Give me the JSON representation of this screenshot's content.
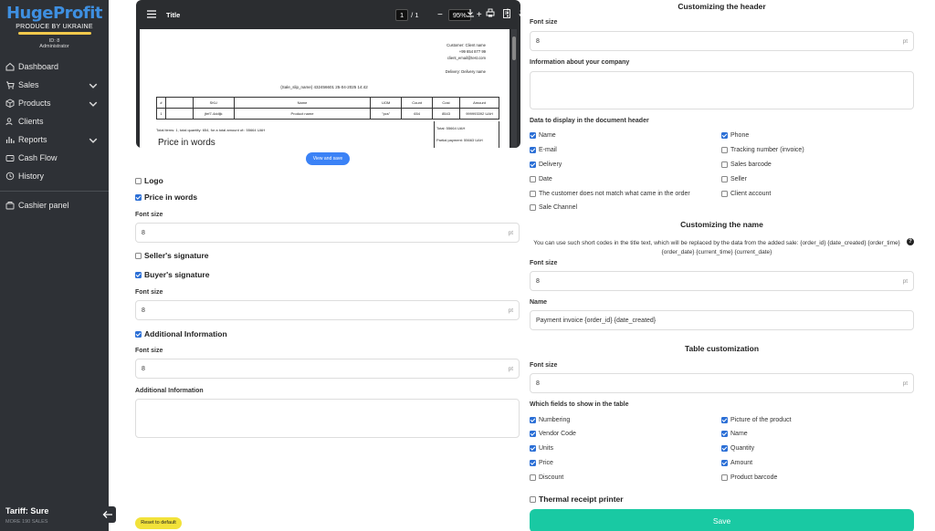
{
  "sidebar": {
    "logo_title": "HugeProfit",
    "logo_sub": "PRODUCE BY UKRAINE",
    "user_id": "ID: 8",
    "user_role": "Administrator",
    "items": [
      {
        "label": "Dashboard"
      },
      {
        "label": "Sales"
      },
      {
        "label": "Products"
      },
      {
        "label": "Clients"
      },
      {
        "label": "Reports"
      },
      {
        "label": "Cash Flow"
      },
      {
        "label": "History"
      },
      {
        "label": "Cashier panel"
      }
    ],
    "tariff": "Tariff: Sure",
    "tariff_sub": "MORE 190 SALES"
  },
  "preview": {
    "title": "Title",
    "page_current": "1",
    "page_total": "/ 1",
    "zoom": "95%",
    "doc": {
      "customer": "Customer: Client name",
      "phone": "+99 654 877 99",
      "email": "client_email@test.com",
      "delivery": "Delivery: Delivery name",
      "heading": "{Sale_slip_name} 432456601 25-04-2025 14:42",
      "table_header": [
        "#",
        "SKU",
        "Name",
        "UOM",
        "Count",
        "Cost",
        "Amount"
      ],
      "table_row": [
        "1",
        "jfef7-4ddljk",
        "Product name",
        "\"pcs\"",
        "654",
        "8543",
        "999993392 UAH"
      ],
      "totals_text": "Total items: 1, total quantity: 654, for a total amount of:: 55664 UAH",
      "words": "Price in words",
      "total": "Total: 55664 UAH",
      "partial": "Partial payment: 55663 UAH"
    },
    "view_button": "View and save"
  },
  "left_form": {
    "logo_label": "Logo",
    "price_words_label": "Price in words",
    "font_size_label": "Font size",
    "font_size_value": "8",
    "unit": "pt",
    "seller_sig_label": "Seller's signature",
    "buyer_sig_label": "Buyer's signature",
    "additional_label": "Additional Information",
    "additional_area_label": "Additional Information",
    "reset_button": "Reset to default"
  },
  "right_form": {
    "header_title": "Customizing the header",
    "font_size_label": "Font size",
    "font_size_value": "8",
    "unit": "pt",
    "company_label": "Information about your company",
    "data_header_label": "Data to display in the document header",
    "header_fields": [
      {
        "label": "Name",
        "checked": true
      },
      {
        "label": "Phone",
        "checked": true
      },
      {
        "label": "E-mail",
        "checked": true
      },
      {
        "label": "Tracking number (invoice)",
        "checked": false
      },
      {
        "label": "Delivery",
        "checked": true
      },
      {
        "label": "Sales barcode",
        "checked": false
      },
      {
        "label": "Date",
        "checked": false
      },
      {
        "label": "Seller",
        "checked": false
      },
      {
        "label": "The customer does not match what came in the order",
        "checked": false
      },
      {
        "label": "Client account",
        "checked": false
      },
      {
        "label": "Sale Channel",
        "checked": false
      }
    ],
    "name_title": "Customizing the name",
    "name_hint": "You can use such short codes in the title text, which will be replaced by the data from the added sale: {order_id} {date_created} {order_time} {order_date} {current_time} {current_date}",
    "name_label": "Name",
    "name_value": "Payment invoice {order_id} {date_created}",
    "table_title": "Table customization",
    "table_fields_label": "Which fields to show in the table",
    "table_fields": [
      {
        "label": "Numbering",
        "checked": true
      },
      {
        "label": "Picture of the product",
        "checked": true
      },
      {
        "label": "Vendor Code",
        "checked": true
      },
      {
        "label": "Name",
        "checked": true
      },
      {
        "label": "Units",
        "checked": true
      },
      {
        "label": "Quantity",
        "checked": true
      },
      {
        "label": "Price",
        "checked": true
      },
      {
        "label": "Amount",
        "checked": true
      },
      {
        "label": "Discount",
        "checked": false
      },
      {
        "label": "Product barcode",
        "checked": false
      }
    ],
    "thermal_label": "Thermal receipt printer",
    "save_button": "Save"
  }
}
